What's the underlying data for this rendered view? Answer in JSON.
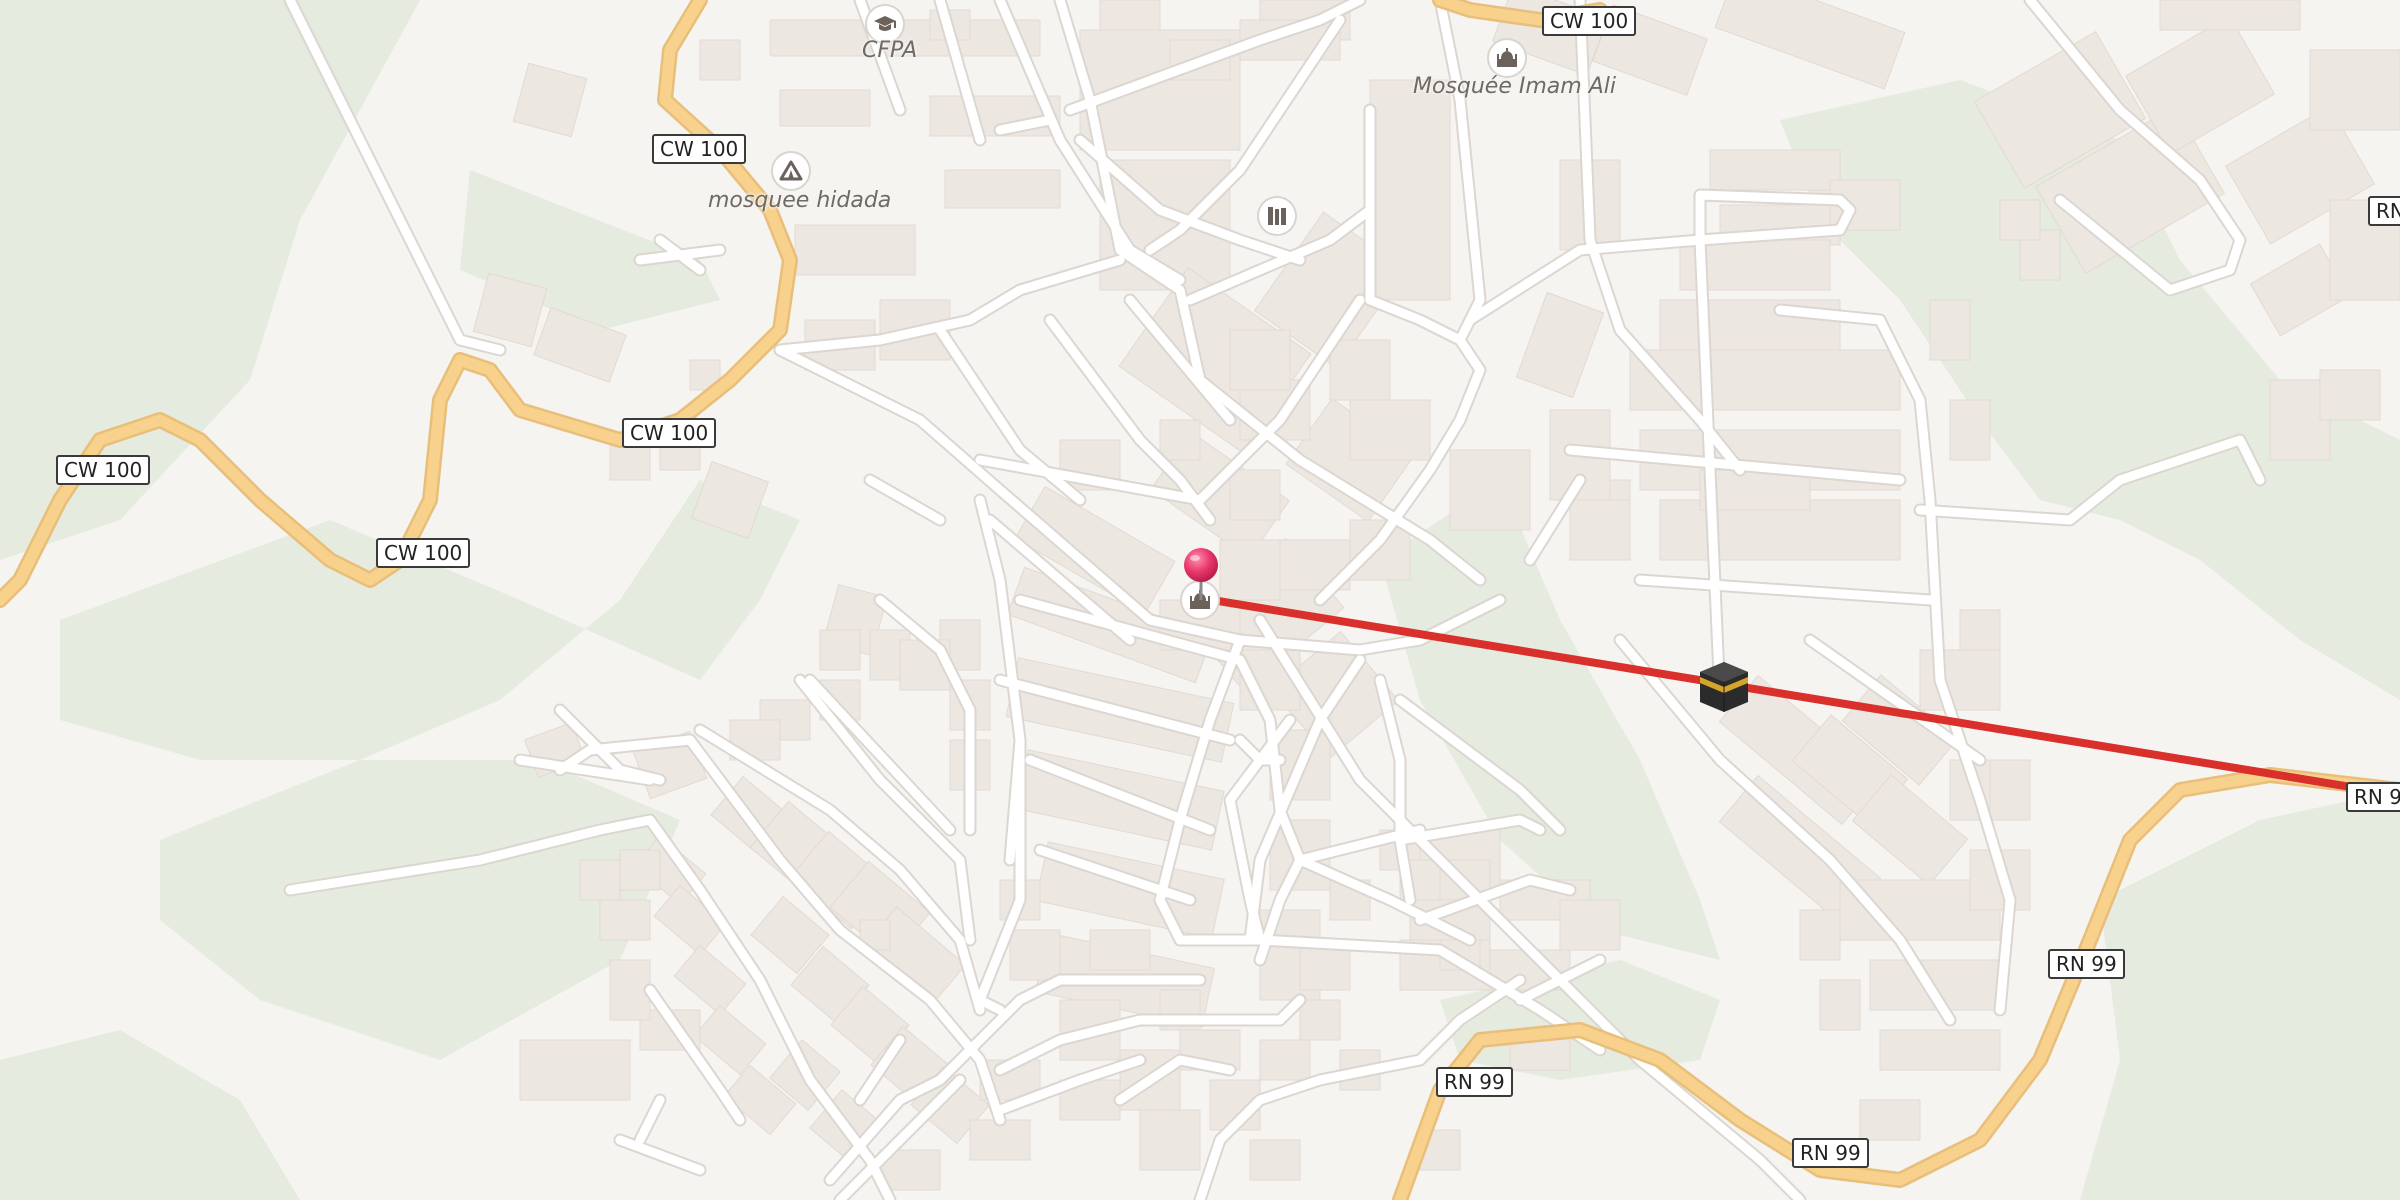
{
  "map": {
    "colors": {
      "background": "#f6f4f1",
      "greenery": "#e5ebdf",
      "building": "#ede7e1",
      "minor_road": "#ffffff",
      "major_road": "#f8d28c",
      "route_line": "#d9302c",
      "pin": "#e8386b"
    },
    "road_labels": [
      {
        "id": "cw100-1",
        "text": "CW 100"
      },
      {
        "id": "cw100-2",
        "text": "CW 100"
      },
      {
        "id": "cw100-3",
        "text": "CW 100"
      },
      {
        "id": "cw100-4",
        "text": "CW 100"
      },
      {
        "id": "cw100-5",
        "text": "CW 100"
      },
      {
        "id": "rn99-1",
        "text": "RN 99"
      },
      {
        "id": "rn99-2",
        "text": "RN 99"
      },
      {
        "id": "rn99-3",
        "text": "RN 99"
      },
      {
        "id": "rn-partial-1",
        "text": "RN"
      },
      {
        "id": "rn-partial-2",
        "text": "RN 9"
      }
    ],
    "pois": [
      {
        "id": "cfpa",
        "label": "CFPA",
        "icon": "graduation-cap-icon"
      },
      {
        "id": "mosquee-imam-ali",
        "label": "Mosquée Imam Ali",
        "icon": "mosque-icon"
      },
      {
        "id": "mosquee-hidada",
        "label": "mosquee hidada",
        "icon": "tent-icon"
      },
      {
        "id": "library",
        "label": "",
        "icon": "books-icon"
      },
      {
        "id": "origin-mosque",
        "label": "",
        "icon": "mosque-icon"
      }
    ],
    "markers": {
      "origin_pin": {
        "icon": "location-pin-icon"
      },
      "destination": {
        "icon": "kaaba-icon"
      }
    },
    "route": {
      "type": "qibla-direction-line"
    }
  }
}
